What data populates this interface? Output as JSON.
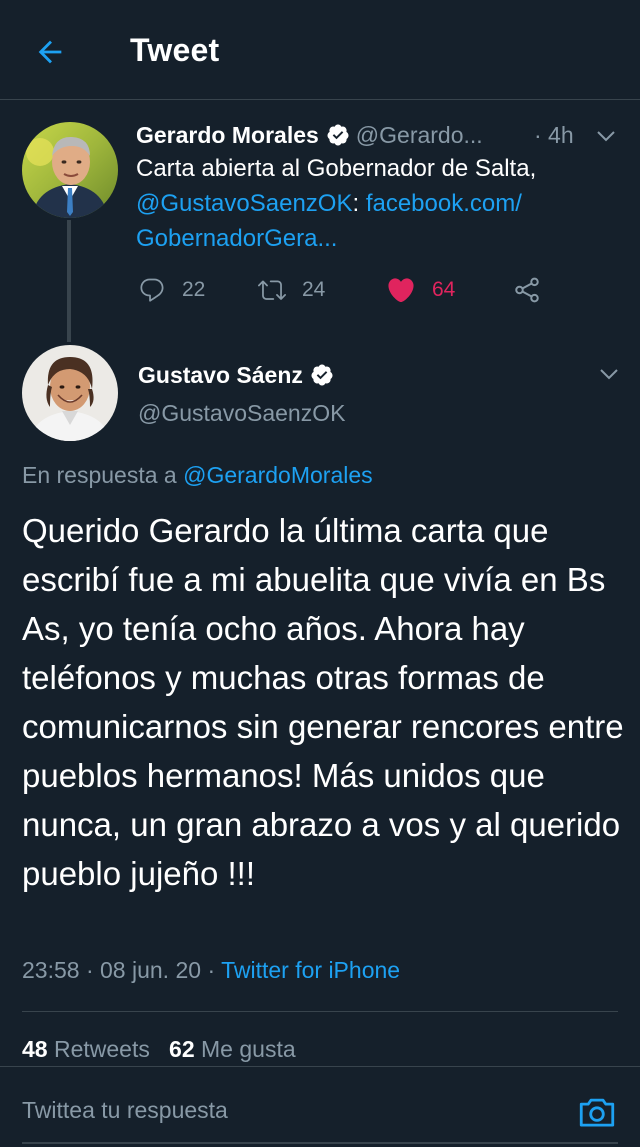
{
  "header": {
    "title": "Tweet",
    "back_icon": "arrow-left-icon"
  },
  "colors": {
    "background": "#15202b",
    "accent": "#1da1f2",
    "like": "#e0245e",
    "muted": "#8899a6",
    "border": "#38444d"
  },
  "parent_tweet": {
    "name": "Gerardo Morales",
    "handle": "@Gerardo...",
    "time": "· 4h",
    "text_plain": "Carta abierta al Gobernador de Salta,",
    "mention": "@GustavoSaenzOK",
    "colon": ":",
    "link_line1": "facebook.com/",
    "link_line2": "GobernadorGera...",
    "actions": {
      "replies": "22",
      "retweets": "24",
      "likes": "64"
    }
  },
  "main_tweet": {
    "name": "Gustavo Sáenz",
    "handle": "@GustavoSaenzOK",
    "reply_prefix": "En respuesta a",
    "reply_handle": "@GerardoMorales",
    "text": "Querido Gerardo la última carta que escribí fue a mi abuelita que vivía en Bs As, yo tenía ocho años. Ahora hay teléfonos y muchas otras formas de comunicarnos sin generar rencores entre pueblos hermanos! Más unidos que nunca, un gran abrazo a vos y al querido pueblo jujeño !!!",
    "time": "23:58",
    "sep": "·",
    "date": "08 jun. 20",
    "source": "Twitter for iPhone",
    "retweets_count": "48",
    "retweets_label": "Retweets",
    "likes_count": "62",
    "likes_label": "Me gusta"
  },
  "reply_bar": {
    "placeholder": "Twittea tu respuesta",
    "camera_icon": "camera-icon"
  }
}
